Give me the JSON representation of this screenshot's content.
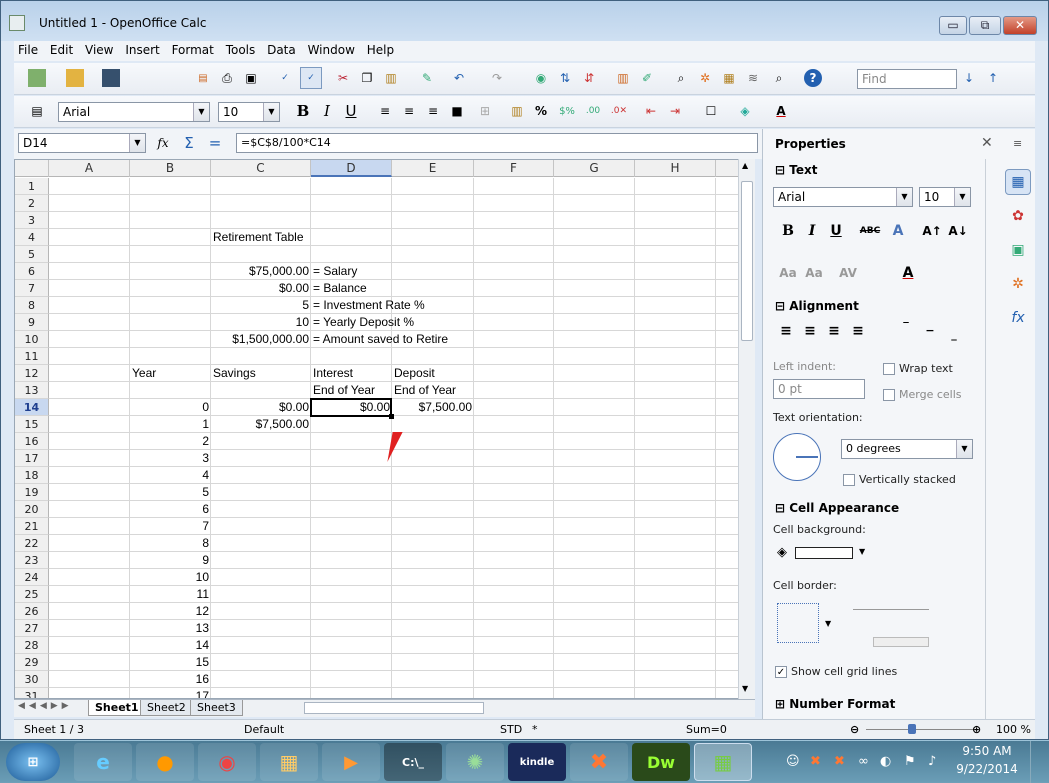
{
  "window": {
    "title": "Untitled 1 - OpenOffice Calc",
    "btn_min": "▭",
    "btn_max": "⧉",
    "btn_close": "✕"
  },
  "menu": [
    "File",
    "Edit",
    "View",
    "Insert",
    "Format",
    "Tools",
    "Data",
    "Window",
    "Help"
  ],
  "toolbar": {
    "find_placeholder": "Find",
    "font_name": "Arial",
    "font_size": "10"
  },
  "formula": {
    "name_box": "D14",
    "content": "=$C$8/100*C14"
  },
  "columns": [
    "A",
    "B",
    "C",
    "D",
    "E",
    "F",
    "G",
    "H"
  ],
  "rows": [
    "1",
    "2",
    "3",
    "4",
    "5",
    "6",
    "7",
    "8",
    "9",
    "10",
    "11",
    "12",
    "13",
    "14",
    "15",
    "16",
    "17",
    "18",
    "19",
    "20",
    "21",
    "22",
    "23",
    "24",
    "25",
    "26",
    "27",
    "28",
    "29",
    "30",
    "31"
  ],
  "cells": {
    "C4": "Retirement Table",
    "C6": "$75,000.00",
    "D6": "= Salary",
    "C7": "$0.00",
    "D7": "= Balance",
    "C8": "5",
    "D8": "= Investment Rate %",
    "C9": "10",
    "D9": "= Yearly Deposit %",
    "C10": "$1,500,000.00",
    "D10": "= Amount saved to Retire",
    "B12": "Year",
    "C12": "Savings",
    "D12": "Interest",
    "E12": "Deposit",
    "D13": "End of Year",
    "E13": "End of Year",
    "C14": "$0.00",
    "D14": "$0.00",
    "E14": "$7,500.00",
    "C15": "$7,500.00"
  },
  "years": [
    "0",
    "1",
    "2",
    "3",
    "4",
    "5",
    "6",
    "7",
    "8",
    "9",
    "10",
    "11",
    "12",
    "13",
    "14",
    "15",
    "16",
    "17"
  ],
  "sheet_tabs": [
    "Sheet1",
    "Sheet2",
    "Sheet3"
  ],
  "status": {
    "sheet": "Sheet 1 / 3",
    "style": "Default",
    "mode": "STD",
    "mod": "*",
    "sum": "Sum=0",
    "zoom": "100 %"
  },
  "sidebar": {
    "title": "Properties",
    "text_section": "Text",
    "font_name": "Arial",
    "font_size": "10",
    "alignment_section": "Alignment",
    "left_indent_label": "Left indent:",
    "left_indent_value": "0 pt",
    "wrap_text": "Wrap text",
    "merge_cells": "Merge cells",
    "text_orientation_label": "Text orientation:",
    "orientation_value": "0 degrees",
    "vertically_stacked": "Vertically stacked",
    "cell_appearance_section": "Cell Appearance",
    "cell_background_label": "Cell background:",
    "cell_border_label": "Cell border:",
    "show_grid": "Show cell grid lines",
    "number_format_section": "Number Format"
  },
  "taskbar": {
    "time": "9:50 AM",
    "date": "9/22/2014",
    "dw_label": "Dw",
    "kindle_label": "kindle"
  },
  "colors": {
    "selection": "#c8d8f0",
    "accent": "#4a74b8"
  }
}
